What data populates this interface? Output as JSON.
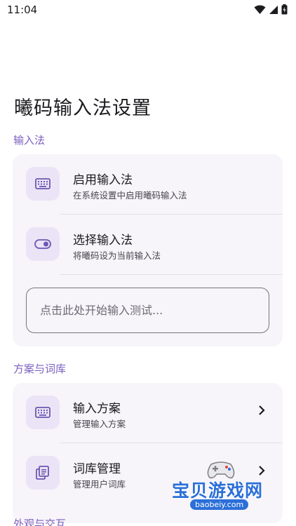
{
  "status_bar": {
    "time": "11:04"
  },
  "page": {
    "title": "曦码输入法设置"
  },
  "sections": [
    {
      "header": "输入法",
      "items": [
        {
          "title": "启用输入法",
          "subtitle": "在系统设置中启用曦码输入法",
          "icon": "keyboard-icon"
        },
        {
          "title": "选择输入法",
          "subtitle": "将曦码设为当前输入法",
          "icon": "toggle-icon"
        }
      ],
      "test_input": {
        "placeholder": "点击此处开始输入测试...",
        "value": ""
      }
    },
    {
      "header": "方案与词库",
      "items": [
        {
          "title": "输入方案",
          "subtitle": "管理输入方案",
          "icon": "keyboard-icon",
          "chevron": true
        },
        {
          "title": "词库管理",
          "subtitle": "管理用户词库",
          "icon": "dictionary-icon",
          "chevron": true
        }
      ]
    },
    {
      "header": "外观与交互"
    }
  ],
  "watermark": {
    "text": "宝贝游戏网",
    "domain": "baobeiy.com"
  },
  "colors": {
    "accent": "#7a5fbf",
    "card_bg": "#f7f4fa",
    "icon_bg": "#ebe4f6",
    "icon_fg": "#6e56b3"
  }
}
